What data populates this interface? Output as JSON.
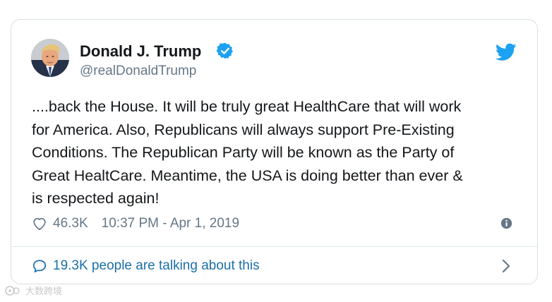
{
  "tweet": {
    "author_name": "Donald J. Trump",
    "handle": "@realDonaldTrump",
    "text_lines": [
      "....back the House. It will be truly great HealthCare that will work",
      "for America. Also, Republicans will always support Pre-Existing",
      "Conditions. The Republican Party will be known as the Party of",
      "Great HealtCare. Meantime, the USA is doing better than ever &",
      "is respected again!"
    ],
    "likes": "46.3K",
    "timestamp": "10:37 PM - Apr 1, 2019",
    "talking": "19.3K people are talking about this"
  },
  "watermark": {
    "text": "大数跨境"
  },
  "icons": {
    "verified": "verified-badge-icon",
    "bird": "twitter-bird-icon",
    "heart": "heart-icon",
    "info": "info-icon",
    "comment": "comment-bubble-icon",
    "chevron": "chevron-right-icon"
  },
  "colors": {
    "twitter_blue": "#1da1f2",
    "text_primary": "#14171a",
    "text_secondary": "#657786",
    "link": "#1b6fa8",
    "border": "#d8dfe4"
  }
}
